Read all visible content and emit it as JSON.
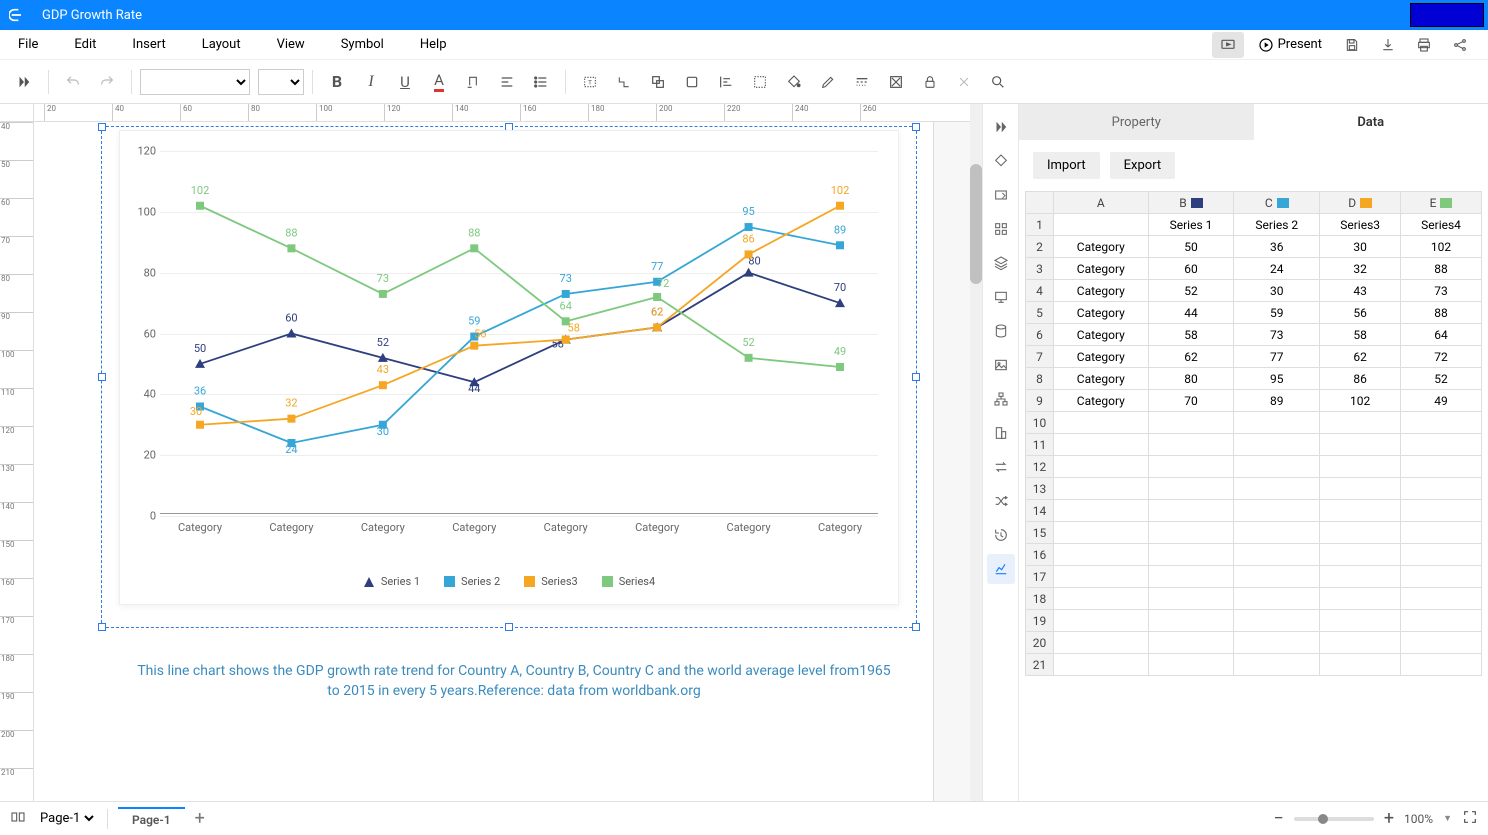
{
  "title": "GDP Growth Rate",
  "menubar": [
    "File",
    "Edit",
    "Insert",
    "Layout",
    "View",
    "Symbol",
    "Help"
  ],
  "present_label": "Present",
  "panel": {
    "tabs": [
      "Property",
      "Data"
    ],
    "active_tab": "Data",
    "buttons": [
      "Import",
      "Export"
    ],
    "columns": [
      "",
      "A",
      "B",
      "C",
      "D",
      "E"
    ],
    "header_row": [
      "",
      "Series 1",
      "Series 2",
      "Series3",
      "Series4"
    ],
    "col_swatches": {
      "B": "#2e3f7f",
      "C": "#36a6d6",
      "D": "#f5a623",
      "E": "#7fc97f"
    },
    "row_label": "Category",
    "total_rows": 21
  },
  "caption": "This line chart shows the GDP growth rate trend for Country A, Country B, Country C and the world average level from1965 to 2015 in every 5 years.Reference: data from worldbank.org",
  "status": {
    "pageselect": "Page-1",
    "pagetab": "Page-1",
    "zoom": "100%"
  },
  "chart_data": {
    "type": "line",
    "categories": [
      "Category",
      "Category",
      "Category",
      "Category",
      "Category",
      "Category",
      "Category",
      "Category"
    ],
    "series": [
      {
        "name": "Series 1",
        "color": "#2e3f7f",
        "marker": "triangle",
        "values": [
          50,
          60,
          52,
          44,
          58,
          62,
          80,
          70
        ]
      },
      {
        "name": "Series 2",
        "color": "#36a6d6",
        "marker": "square",
        "values": [
          36,
          24,
          30,
          59,
          73,
          77,
          95,
          89
        ]
      },
      {
        "name": "Series3",
        "color": "#f5a623",
        "marker": "square",
        "values": [
          30,
          32,
          43,
          56,
          58,
          62,
          86,
          102
        ]
      },
      {
        "name": "Series4",
        "color": "#7fc97f",
        "marker": "square",
        "values": [
          102,
          88,
          73,
          88,
          64,
          72,
          52,
          49
        ]
      }
    ],
    "ylim": [
      0,
      120
    ],
    "yticks": [
      0,
      20,
      40,
      60,
      80,
      100,
      120
    ],
    "xlabel": "",
    "ylabel": "",
    "label_offsets": {
      "Series 1": [
        [
          0,
          -12
        ],
        [
          0,
          -12
        ],
        [
          0,
          -12
        ],
        [
          0,
          10
        ],
        [
          -8,
          8
        ],
        [
          0,
          -12
        ],
        [
          6,
          -8
        ],
        [
          0,
          -12
        ]
      ],
      "Series 2": [
        [
          0,
          -12
        ],
        [
          0,
          10
        ],
        [
          0,
          10
        ],
        [
          0,
          -12
        ],
        [
          0,
          -12
        ],
        [
          0,
          -12
        ],
        [
          0,
          -12
        ],
        [
          0,
          -12
        ]
      ],
      "Series3": [
        [
          -4,
          -10
        ],
        [
          0,
          -12
        ],
        [
          0,
          -12
        ],
        [
          6,
          -8
        ],
        [
          8,
          -8
        ],
        [
          0,
          -12
        ],
        [
          0,
          -12
        ],
        [
          0,
          -12
        ]
      ],
      "Series4": [
        [
          0,
          -12
        ],
        [
          0,
          -12
        ],
        [
          0,
          -12
        ],
        [
          0,
          -12
        ],
        [
          0,
          -12
        ],
        [
          6,
          -10
        ],
        [
          0,
          -12
        ],
        [
          0,
          -12
        ]
      ]
    }
  },
  "ruler_h": [
    20,
    40,
    60,
    80,
    100,
    120,
    140,
    160,
    180,
    200,
    220,
    240,
    260
  ],
  "ruler_v": [
    40,
    50,
    60,
    70,
    80,
    90,
    100,
    110,
    120,
    130,
    140,
    150,
    160,
    170,
    180,
    190,
    200,
    210
  ]
}
